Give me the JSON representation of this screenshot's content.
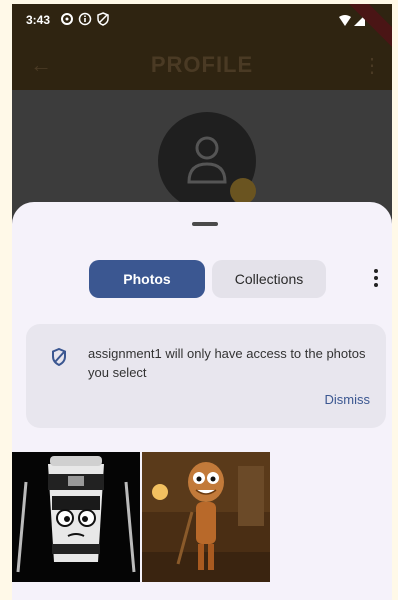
{
  "status_bar": {
    "time": "3:43",
    "left_icons": [
      "settings-icon",
      "info-icon",
      "vpn-key-icon"
    ],
    "right_icons": [
      "wifi-icon",
      "signal-icon",
      "battery-icon"
    ]
  },
  "app_bar": {
    "title": "PROFILE",
    "back_icon": "arrow-left-icon",
    "menu_icon": "more-vert-icon"
  },
  "sheet": {
    "tabs": [
      {
        "label": "Photos",
        "selected": true
      },
      {
        "label": "Collections",
        "selected": false
      }
    ],
    "notice": {
      "text": "assignment1 will only have access to the photos you select",
      "dismiss_label": "Dismiss"
    },
    "photos": [
      "ninja-coffee-cup-photo",
      "cartoon-character-photo"
    ]
  },
  "colors": {
    "primary": "#3b5791",
    "sheet_bg": "#f5f2fa",
    "appbar_bg": "#2f2411"
  }
}
